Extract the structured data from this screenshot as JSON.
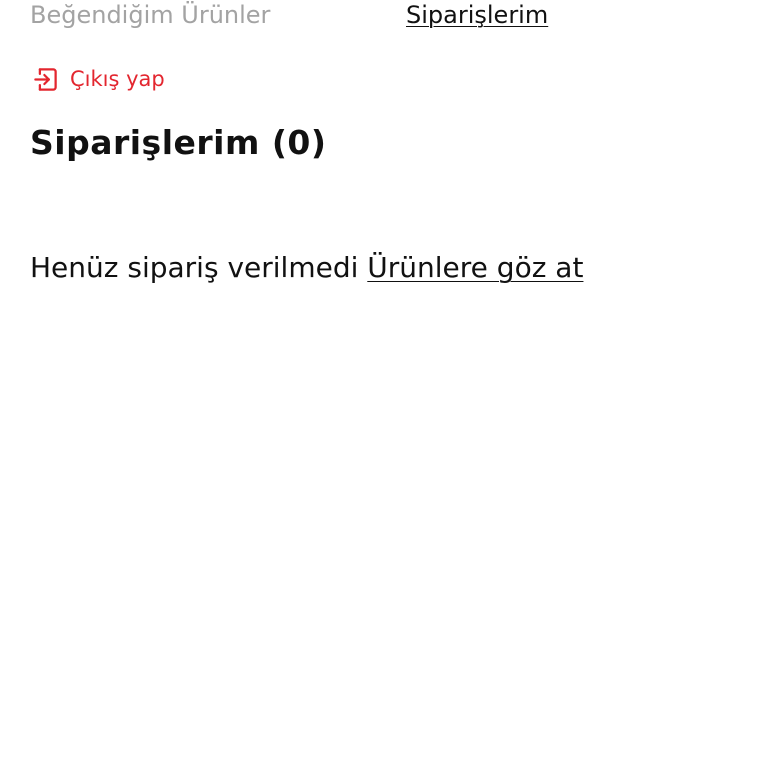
{
  "nav": {
    "liked_products": "Beğendiğim Ürünler",
    "orders": "Siparişlerim"
  },
  "logout": {
    "label": "Çıkış yap",
    "icon": "logout-icon",
    "color": "#e3262f"
  },
  "orders_section": {
    "title": "Siparişlerim (0)",
    "empty_message": "Henüz sipariş verilmedi",
    "browse_link": "Ürünlere göz at"
  }
}
